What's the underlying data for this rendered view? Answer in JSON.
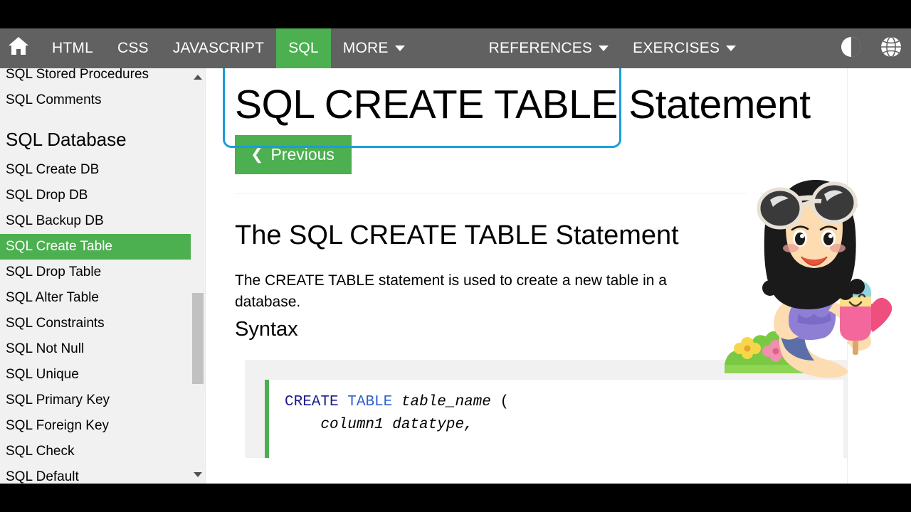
{
  "window": {
    "letterbox_color": "#000000"
  },
  "navbar": {
    "background": "#616161",
    "accent": "#4CAF50",
    "home_icon": "home-icon",
    "items": [
      {
        "label": "HTML",
        "active": false,
        "caret": false
      },
      {
        "label": "CSS",
        "active": false,
        "caret": false
      },
      {
        "label": "JAVASCRIPT",
        "active": false,
        "caret": false
      },
      {
        "label": "SQL",
        "active": true,
        "caret": false
      },
      {
        "label": "MORE",
        "active": false,
        "caret": true
      },
      {
        "label": "REFERENCES",
        "active": false,
        "caret": true
      },
      {
        "label": "EXERCISES",
        "active": false,
        "caret": true
      }
    ],
    "right_icons": [
      {
        "name": "dark-mode-contrast-icon",
        "glyph": "half-circle"
      },
      {
        "name": "translate-globe-icon",
        "glyph": "globe"
      }
    ]
  },
  "sidebar": {
    "background": "#f1f1f1",
    "active_color": "#4CAF50",
    "items": [
      {
        "type": "link",
        "label": "SQL Stored Procedures",
        "active": false
      },
      {
        "type": "link",
        "label": "SQL Comments",
        "active": false
      },
      {
        "type": "heading",
        "label": "SQL Database"
      },
      {
        "type": "link",
        "label": "SQL Create DB",
        "active": false
      },
      {
        "type": "link",
        "label": "SQL Drop DB",
        "active": false
      },
      {
        "type": "link",
        "label": "SQL Backup DB",
        "active": false
      },
      {
        "type": "link",
        "label": "SQL Create Table",
        "active": true
      },
      {
        "type": "link",
        "label": "SQL Drop Table",
        "active": false
      },
      {
        "type": "link",
        "label": "SQL Alter Table",
        "active": false
      },
      {
        "type": "link",
        "label": "SQL Constraints",
        "active": false
      },
      {
        "type": "link",
        "label": "SQL Not Null",
        "active": false
      },
      {
        "type": "link",
        "label": "SQL Unique",
        "active": false
      },
      {
        "type": "link",
        "label": "SQL Primary Key",
        "active": false
      },
      {
        "type": "link",
        "label": "SQL Foreign Key",
        "active": false
      },
      {
        "type": "link",
        "label": "SQL Check",
        "active": false
      },
      {
        "type": "link",
        "label": "SQL Default",
        "active": false
      }
    ],
    "scrollbar": {
      "up_arrow": "scroll-up-arrow-icon",
      "down_arrow": "scroll-down-arrow-icon",
      "thumb_color": "#c1c1c1"
    }
  },
  "main": {
    "title_highlighted": "SQL CREATE TABLE",
    "title_rest": " Statement",
    "highlight_box_color": "#1b9dd9",
    "prev_button": {
      "chevron": "❮",
      "label": "Previous"
    },
    "section_heading": "The SQL CREATE TABLE Statement",
    "paragraph": "The CREATE TABLE statement is used to create a new table in a database.",
    "syntax_heading": "Syntax",
    "code": {
      "keyword1": "CREATE",
      "keyword2": "TABLE",
      "identifier": "table_name",
      "open_paren": " (",
      "line2": "    column1 datatype,",
      "border_color": "#4CAF50"
    }
  },
  "mascot": {
    "name": "w3schools-summer-girl-illustration",
    "description": "Cartoon girl with sunglasses on her head holding an ice cream popsicle, sitting near flowers",
    "colors": {
      "hair": "#1a1a1a",
      "skin": "#fcdcb0",
      "top": "#8f7fd4",
      "shorts": "#5b6ea8",
      "popsicle_pink": "#f4679d",
      "popsicle_yellow": "#fbe08a",
      "popsicle_blue": "#8fd6e0",
      "grass": "#7ac943",
      "heart": "#ef4f7e"
    }
  }
}
